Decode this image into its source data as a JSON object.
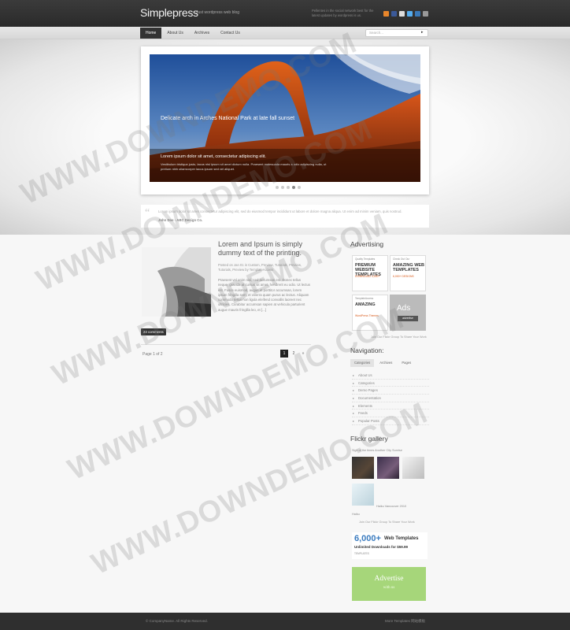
{
  "header": {
    "logo": "Simplepress",
    "tagline": "Just wordpress web blog",
    "note": "Pellentes in the social network best for the latest updates by wordpress is us.",
    "social_icons": [
      "rss-icon",
      "facebook-icon",
      "delicious-icon",
      "twitter-icon",
      "digg-icon",
      "stumble-icon"
    ],
    "social_colors": [
      "#e8862b",
      "#3b5998",
      "#dddddd",
      "#55acee",
      "#3a79b8",
      "#999999"
    ]
  },
  "nav": {
    "items": [
      "Home",
      "About Us",
      "Archives",
      "Contact Us"
    ],
    "active": "Home",
    "search_placeholder": "Search..."
  },
  "slider": {
    "caption": "Delicate arch in Arches National Park at late fall sunset",
    "band_title": "Lorem ipsum dolor sit amet, consectetur adipiscing elit.",
    "band_text": "Vestibulum tristique justo, lacus nisi ipsum sit amet dictum nulla. Praesent malesuada mauris a odio adipiscing nulla, ut pretium nibh ullamcorper lacus ipsum sed vel aliquet.",
    "dots": 5,
    "active_dot": 4
  },
  "quote": {
    "text": "Lorem ipsum dolor sit amet consectetur adipiscing elit, sed do eiusmod tempor incididunt ut labore et dolore magna aliqua. Ut enim ad minim veniam, quis nostrud.",
    "author": "John Doe - ABC Design Co."
  },
  "post": {
    "title": "Lorem and Ipsum is simply dummy text of the printing.",
    "meta": "Posted on Jan 01 in Custom, Preview, Tutorials, Preview, Tutorials, Preview by TemplateAccess",
    "excerpt": "Praesent vel enim nisi, sed accumsan est. Donec tellus neque, gravida at cursus sit amet, hendrerit eu odio. Ut lectus est. Fusce euismod, augue et porttitor accumsan, lorem ipsum fringilla sem, et viverra quam purus ac lectus. Aliquam commodo tellus non ligula eleifend convallis laoreet nec ultricies. Curabitur accumsan sapien at vehicula parturient augue mauris fringilla leo, et [...]",
    "comments": "23 comments"
  },
  "pagination": {
    "label": "Page 1 of 2",
    "pages": [
      "1",
      "2",
      "»"
    ]
  },
  "sidebar": {
    "advertising_title": "Advertising",
    "ads": [
      {
        "small": "Quality Templates",
        "big": "PREMIUM WEBSITE TEMPLATES",
        "sub": "DOWNLOAD 3,000+"
      },
      {
        "small": "Check Out Our",
        "big": "AMAZING WEB TEMPLATES",
        "sub": "6,000+ DESIGNS"
      },
      {
        "small": "TemplateAccess",
        "big": "AMAZING",
        "sub": "WordPress Themes"
      },
      {
        "big": "Ads",
        "button": "advertise"
      }
    ],
    "ads_cta": "Join Our Flickr Group To Share Your Work",
    "navigation_title": "Navigation:",
    "nav_tabs": [
      "Categories",
      "Archives",
      "Pages"
    ],
    "nav_items": [
      "About Us",
      "Categories",
      "Demo Pages",
      "Documentation",
      "Elements",
      "Feeds",
      "Popular Posts"
    ],
    "flickr_title": "Flickr gallery",
    "flickr_captions_top": "Sign of the times  Another City Sunrise",
    "flickr_captions_mid": "Haiku  Vancouver 2010",
    "flickr_captions_low": "Haiku",
    "flickr_cta": "Join Our Flickr Group To Share Your Work",
    "banner1": {
      "big": "6,000+",
      "title": "Web Templates",
      "sub": "Unlimited Downloads for $59.99",
      "small": "TEMPLATES"
    },
    "banner2": {
      "title": "Advertise",
      "sub": "with us"
    }
  },
  "footer": {
    "copyright": "© CompanyName. All Rights Reserved.",
    "credit": "More Templates 网站模板"
  },
  "watermark": "WWW.DOWNDEMO.COM"
}
